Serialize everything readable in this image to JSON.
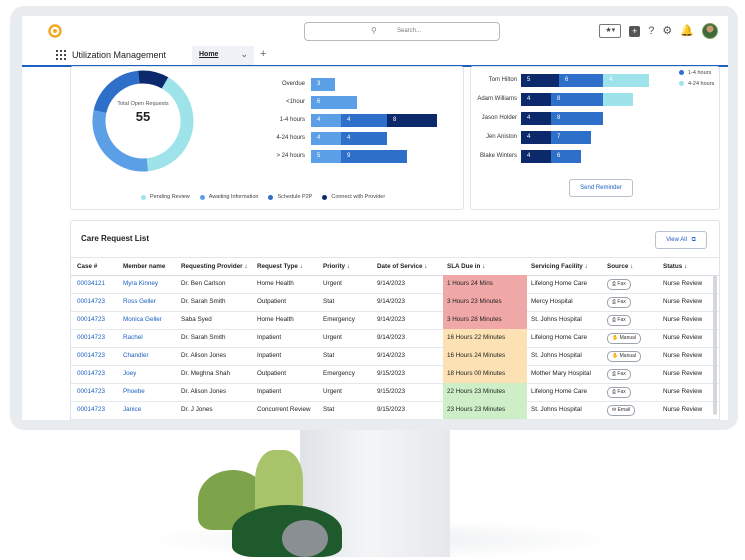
{
  "app": {
    "title": "Utilization Management",
    "tab": "Home",
    "search_placeholder": "Search..."
  },
  "donut": {
    "label": "Total Open Requests",
    "value": "55",
    "segments": [
      {
        "name": "Pending Review",
        "value": 40,
        "color": "#9fe3ea"
      },
      {
        "name": "Awaiting Information",
        "value": 30,
        "color": "#5b9fe6"
      },
      {
        "name": "Schedule P2P",
        "value": 20,
        "color": "#2d6fc9"
      },
      {
        "name": "Connect with Provider",
        "value": 10,
        "color": "#0c2a6b"
      }
    ]
  },
  "legend": [
    "Pending Review",
    "Awaiting Information",
    "Schedule P2P",
    "Connect with Provider"
  ],
  "sla_bars": [
    {
      "label": "Overdue",
      "segments": [
        {
          "value": "3",
          "color": "#5b9fe6",
          "w": 24
        }
      ]
    },
    {
      "label": "<1hour",
      "segments": [
        {
          "value": "6",
          "color": "#5b9fe6",
          "w": 46
        }
      ]
    },
    {
      "label": "1-4 hours",
      "segments": [
        {
          "value": "4",
          "color": "#5b9fe6",
          "w": 30
        },
        {
          "value": "4",
          "color": "#2d6fc9",
          "w": 46
        },
        {
          "value": "8",
          "color": "#0c2a6b",
          "w": 50
        }
      ]
    },
    {
      "label": "4-24 hours",
      "segments": [
        {
          "value": "4",
          "color": "#5b9fe6",
          "w": 30
        },
        {
          "value": "4",
          "color": "#2d6fc9",
          "w": 46
        }
      ]
    },
    {
      "label": "> 24 hours",
      "segments": [
        {
          "value": "5",
          "color": "#5b9fe6",
          "w": 30
        },
        {
          "value": "9",
          "color": "#2d6fc9",
          "w": 66
        }
      ]
    }
  ],
  "reviewer_bars": [
    {
      "label": "Tom Hilton",
      "segments": [
        {
          "value": "5",
          "color": "#0c2a6b",
          "w": 38
        },
        {
          "value": "6",
          "color": "#2d6fc9",
          "w": 44
        },
        {
          "value": "4",
          "color": "#9fe3ea",
          "w": 46
        }
      ]
    },
    {
      "label": "Adam Williams",
      "segments": [
        {
          "value": "4",
          "color": "#0c2a6b",
          "w": 30
        },
        {
          "value": "8",
          "color": "#2d6fc9",
          "w": 52
        },
        {
          "value": "",
          "color": "#9fe3ea",
          "w": 30
        }
      ]
    },
    {
      "label": "Jason Holder",
      "segments": [
        {
          "value": "4",
          "color": "#0c2a6b",
          "w": 30
        },
        {
          "value": "8",
          "color": "#2d6fc9",
          "w": 52
        }
      ]
    },
    {
      "label": "Jen Aniston",
      "segments": [
        {
          "value": "4",
          "color": "#0c2a6b",
          "w": 30
        },
        {
          "value": "7",
          "color": "#2d6fc9",
          "w": 40
        }
      ]
    },
    {
      "label": "Blake Winters",
      "segments": [
        {
          "value": "4",
          "color": "#0c2a6b",
          "w": 30
        },
        {
          "value": "6",
          "color": "#2d6fc9",
          "w": 30
        }
      ]
    }
  ],
  "reviewer_legend": [
    {
      "label": "1-4 hours",
      "color": "#2d6fc9"
    },
    {
      "label": "4-24 hours",
      "color": "#9fe3ea"
    }
  ],
  "send_reminder": "Send Reminder",
  "care": {
    "title": "Care Request List",
    "view_all": "View All",
    "headers": [
      "Case #",
      "Member name",
      "Requesting Provider ↓",
      "Request Type ↓",
      "Priority ↓",
      "Date of Service ↓",
      "SLA Due in ↓",
      "Servicing Facility ↓",
      "Source ↓",
      "Status ↓"
    ],
    "rows": [
      {
        "case": "00034121",
        "member": "Myra Kinney",
        "provider": "Dr. Ben Carlson",
        "type": "Home Health",
        "priority": "Urgent",
        "date": "9/14/2023",
        "sla": "1 Hours 24 Mins",
        "sla_color": "#f0a7a7",
        "facility": "Lifelong Home Care",
        "source": "Fax",
        "status": "Nurse Review"
      },
      {
        "case": "00014723",
        "member": "Ross Geller",
        "provider": "Dr. Sarah Smith",
        "type": "Outpatient",
        "priority": "Stat",
        "date": "9/14/2023",
        "sla": "3 Hours 23 Minutes",
        "sla_color": "#f0a7a7",
        "facility": "Mercy Hospital",
        "source": "Fax",
        "status": "Nurse Review"
      },
      {
        "case": "00014723",
        "member": "Monica Geller",
        "provider": "Saba Syed",
        "type": "Home Health",
        "priority": "Emergency",
        "date": "9/14/2023",
        "sla": "3 Hours 28 Minutes",
        "sla_color": "#f0a7a7",
        "facility": "St. Johns Hospital",
        "source": "Fax",
        "status": "Nurse Review"
      },
      {
        "case": "00014723",
        "member": "Rachel",
        "provider": "Dr. Sarah Smith",
        "type": "Inpatient",
        "priority": "Urgent",
        "date": "9/14/2023",
        "sla": "16 Hours 22 Minutes",
        "sla_color": "#fbe1b3",
        "facility": "Lifelong Home Care",
        "source": "Manual",
        "status": "Nurse Review"
      },
      {
        "case": "00014723",
        "member": "Chandler",
        "provider": "Dr. Alison Jones",
        "type": "Inpatient",
        "priority": "Stat",
        "date": "9/14/2023",
        "sla": "16 Hours 24 Minutes",
        "sla_color": "#fbe1b3",
        "facility": "St. Johns Hospital",
        "source": "Manual",
        "status": "Nurse Review"
      },
      {
        "case": "00014723",
        "member": "Joey",
        "provider": "Dr. Meghna Shah",
        "type": "Outpatient",
        "priority": "Emergency",
        "date": "9/15/2023",
        "sla": "18 Hours 00 Minutes",
        "sla_color": "#fbe1b3",
        "facility": "Mother Mary Hospital",
        "source": "Fax",
        "status": "Nurse Review"
      },
      {
        "case": "00014723",
        "member": "Phoebe",
        "provider": "Dr. Alison Jones",
        "type": "Inpatient",
        "priority": "Urgent",
        "date": "9/15/2023",
        "sla": "22 Hours 23 Minutes",
        "sla_color": "#cdeec6",
        "facility": "Lifelong Home Care",
        "source": "Fax",
        "status": "Nurse Review"
      },
      {
        "case": "00014723",
        "member": "Janice",
        "provider": "Dr. J Jones",
        "type": "Concurrent Review",
        "priority": "Stat",
        "date": "9/15/2023",
        "sla": "23 Hours 23 Minutes",
        "sla_color": "#cdeec6",
        "facility": "St. Johns Hospital",
        "source": "Email",
        "status": "Nurse Review"
      }
    ]
  }
}
